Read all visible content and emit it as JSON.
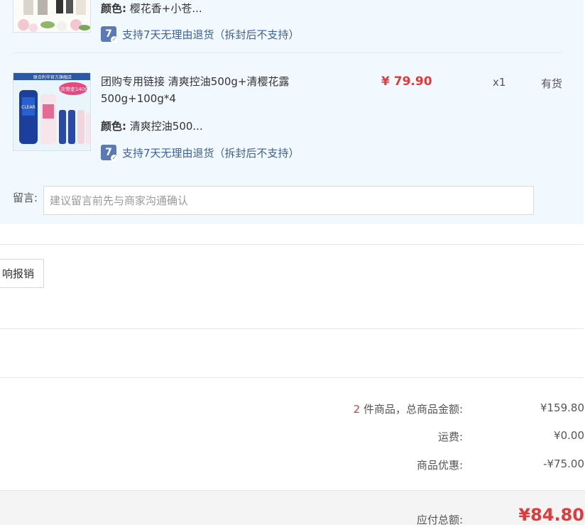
{
  "items": [
    {
      "color_key": "颜色:",
      "color_value": "樱花香+小苍...",
      "return_badge": "7",
      "return_policy": "支持7天无理由退货（拆封后不支持）"
    },
    {
      "title": "团购专用链接 清爽控油500g+清樱花露500g+100g*4",
      "price": "¥ 79.90",
      "quantity": "x1",
      "stock": "有货",
      "color_key": "颜色:",
      "color_value": "清爽控油500...",
      "return_badge": "7",
      "return_policy": "支持7天无理由退货（拆封后不支持）",
      "image_banner": "联合利华官方旗舰店",
      "image_brand": "CLEAR",
      "image_badge": "一次带走1400g"
    }
  ],
  "message": {
    "label": "留言:",
    "placeholder": "建议留言前先与商家沟通确认"
  },
  "reimburse_button": "响报销",
  "summary": {
    "count": "2",
    "count_suffix": "件商品，总商品金额:",
    "goods_total": "¥159.80",
    "shipping_label": "运费:",
    "shipping_value": "¥0.00",
    "discount_label": "商品优惠:",
    "discount_value": "-¥75.00",
    "payable_label": "应付总额:",
    "payable_value": "¥84.80"
  },
  "colors": {
    "panel_bg": "#f2f9fe",
    "price_red": "#e4393c",
    "link_blue": "#3c5f9f",
    "badge_blue": "#5a79b6",
    "total_bar_bg": "#f4f4f4"
  }
}
